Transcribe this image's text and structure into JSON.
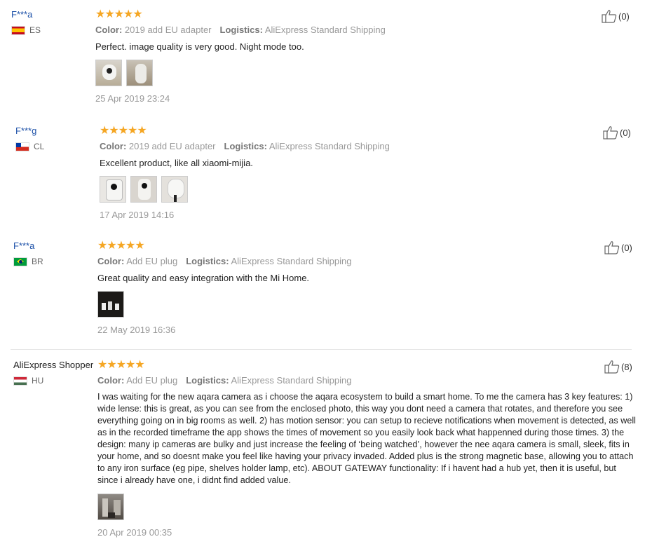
{
  "reviews": [
    {
      "user": "F***a",
      "country": "ES",
      "color_label": "Color:",
      "color": "2019 add EU adapter",
      "logistics_label": "Logistics:",
      "logistics": "AliExpress Standard Shipping",
      "text": "Perfect. image quality is very good. Night mode too.",
      "date": "25 Apr 2019 23:24",
      "likes": "(0)"
    },
    {
      "user": "F***g",
      "country": "CL",
      "color_label": "Color:",
      "color": "2019 add EU adapter",
      "logistics_label": "Logistics:",
      "logistics": "AliExpress Standard Shipping",
      "text": "Excellent product, like all xiaomi-mijia.",
      "date": "17 Apr 2019 14:16",
      "likes": "(0)"
    },
    {
      "user": "F***a",
      "country": "BR",
      "color_label": "Color:",
      "color": "Add EU plug",
      "logistics_label": "Logistics:",
      "logistics": "AliExpress Standard Shipping",
      "text": "Great quality and easy integration with the Mi Home.",
      "date": "22 May 2019 16:36",
      "likes": "(0)"
    },
    {
      "user": "AliExpress Shopper",
      "country": "HU",
      "color_label": "Color:",
      "color": "Add EU plug",
      "logistics_label": "Logistics:",
      "logistics": "AliExpress Standard Shipping",
      "text": "I was waiting for the new aqara camera as i choose the aqara ecosystem to build a smart home. To me the camera has 3 key features: 1) wide lense: this is great, as you can see from the enclosed photo, this way you dont need a camera that rotates, and therefore you see everything going on in big rooms as well. 2) has motion sensor: you can setup to recieve notifications when movement is detected, as well as in the recorded timeframe the app shows the times of movement so you easily look back what happenned during those times. 3) the design: many ip cameras are bulky and just increase the feeling of ‘being watched’, however the nee aqara camera is small, sleek, fits in your home, and so doesnt make you feel like having your privacy invaded. Added plus is the strong magnetic base, allowing you to attach to any iron surface (eg pipe, shelves holder lamp, etc). ABOUT GATEWAY functionality: If i havent had a hub yet, then it is useful, but since i already have one, i didnt find added value.",
      "date": "20 Apr 2019 00:35",
      "likes": "(8)"
    }
  ],
  "stars": "★★★★★",
  "icons": {
    "like": "thumbs-up-icon"
  },
  "colors": {
    "name_link": "#1d51a8",
    "star": "#f5a623",
    "meta": "#999999"
  }
}
